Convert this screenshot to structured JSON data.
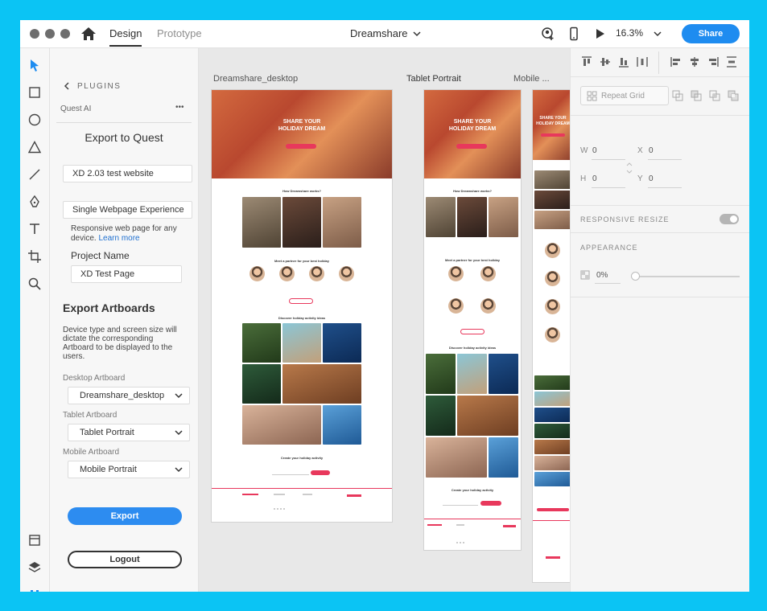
{
  "topbar": {
    "tab_design": "Design",
    "tab_prototype": "Prototype",
    "document_title": "Dreamshare",
    "zoom": "16.3%",
    "share_label": "Share"
  },
  "panel": {
    "back_label": "PLUGINS",
    "plugin_name": "Quest AI",
    "more_label": "•••",
    "heading": "Export to Quest",
    "project_value": "XD 2.03 test website",
    "type_value": "Single Webpage Experience",
    "type_help": "Responsive web page for any device.",
    "learn_more": "Learn more",
    "project_name_label": "Project Name",
    "page_name_value": "XD Test Page",
    "artboards_heading": "Export Artboards",
    "artboards_help": "Device type and screen size will dictate the corresponding Artboard to be displayed to the users.",
    "desktop_label": "Desktop Artboard",
    "desktop_value": "Dreamshare_desktop",
    "tablet_label": "Tablet Artboard",
    "tablet_value": "Tablet Portrait",
    "mobile_label": "Mobile Artboard",
    "mobile_value": "Mobile Portrait",
    "export_label": "Export",
    "logout_label": "Logout"
  },
  "canvas": {
    "desktop_label": "Dreamshare_desktop",
    "tablet_label": "Tablet Portrait",
    "mobile_label": "Mobile ..."
  },
  "mockup": {
    "hero_title_1": "SHARE YOUR",
    "hero_title_2": "HOLIDAY DREAM",
    "sec_how": "How Dreamshare works?",
    "sec_meet": "Meet a partner for your best holiday",
    "sec_discover": "Discover holiday activity ideas",
    "sec_create": "Create your holiday activity",
    "accent": "#e8385c"
  },
  "inspector": {
    "repeat_grid_label": "Repeat Grid",
    "w_label": "W",
    "w_value": "0",
    "x_label": "X",
    "x_value": "0",
    "h_label": "H",
    "h_value": "0",
    "y_label": "Y",
    "y_value": "0",
    "responsive_label": "RESPONSIVE RESIZE",
    "appearance_label": "APPEARANCE",
    "opacity_value": "0%"
  }
}
